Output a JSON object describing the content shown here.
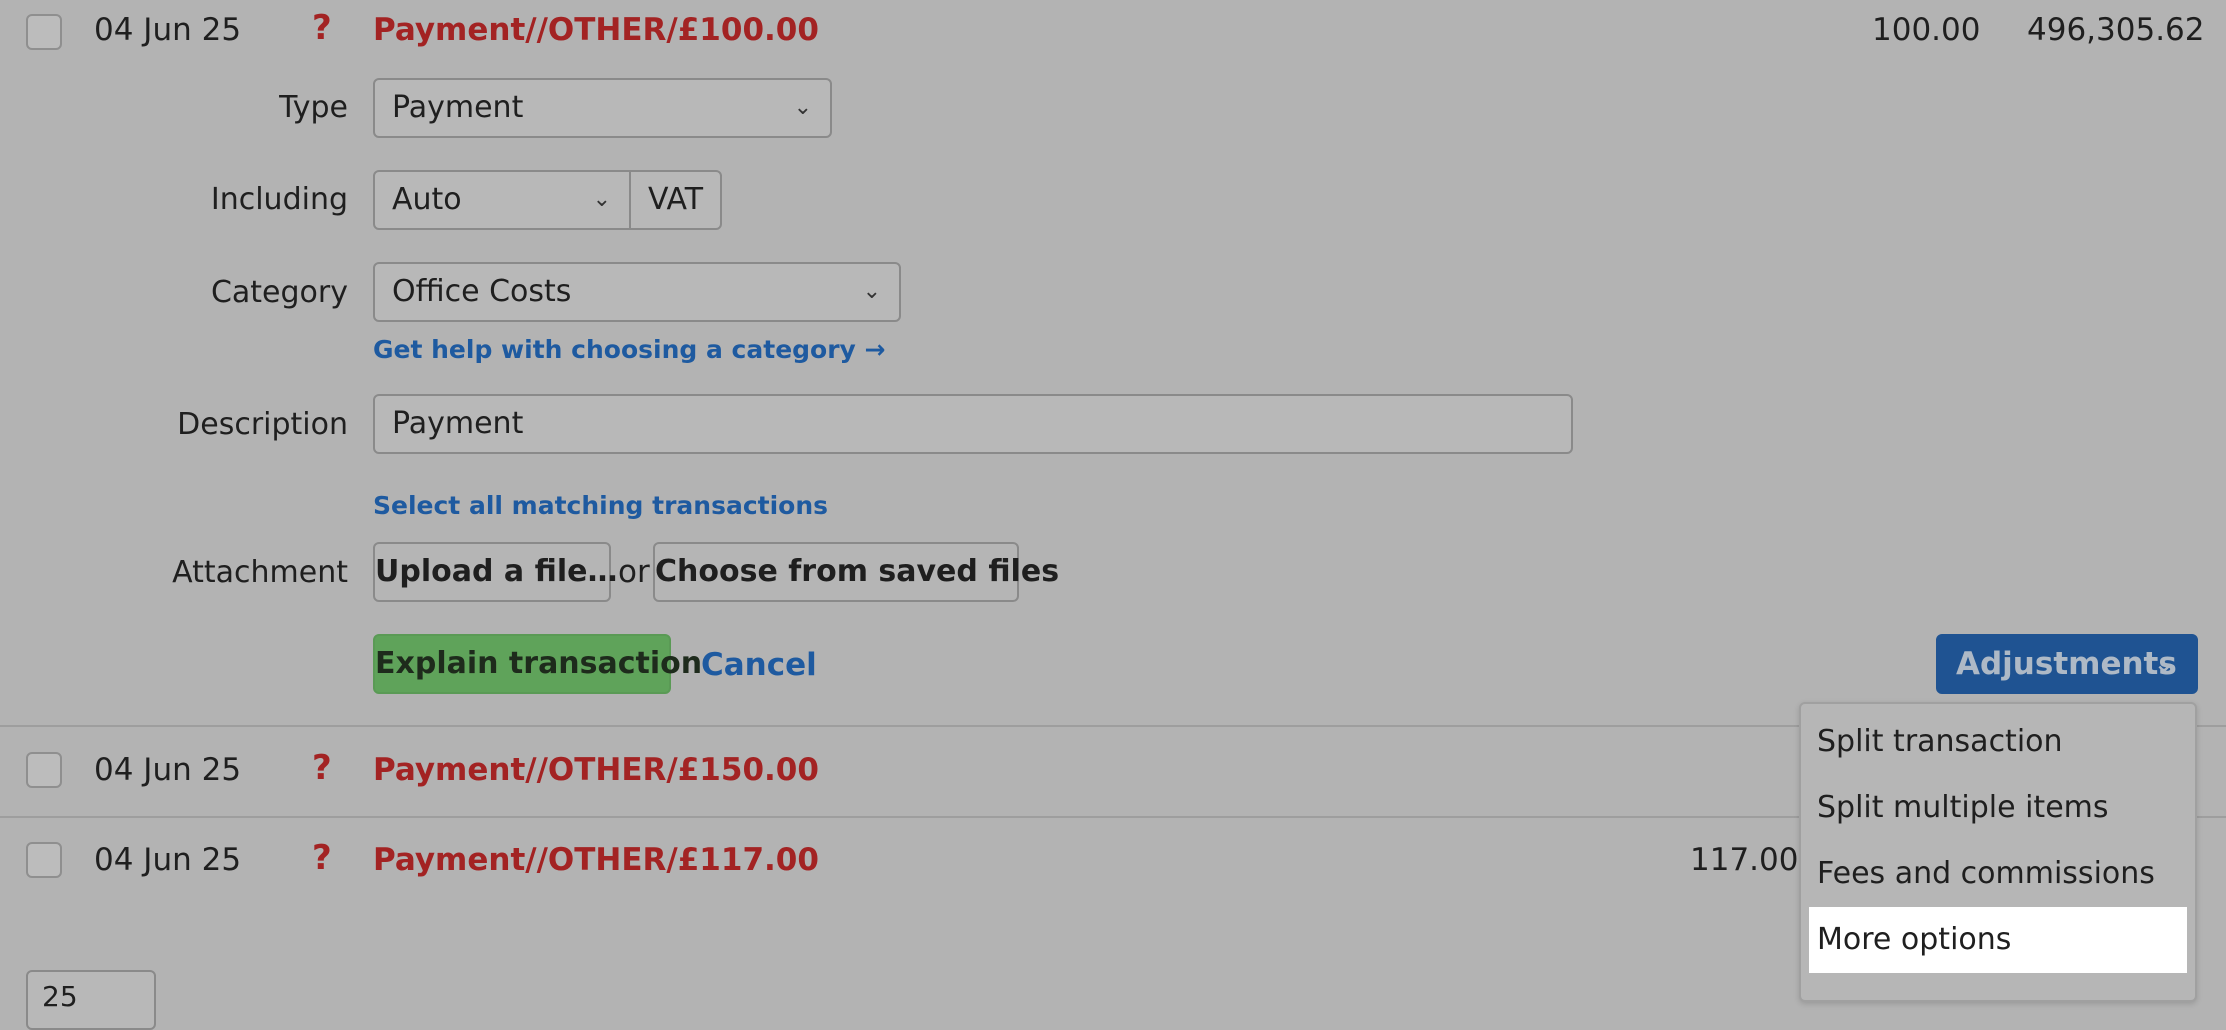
{
  "rows": [
    {
      "date": "04 Jun 25",
      "status": "?",
      "description": "Payment//OTHER/£100.00",
      "amount": "100.00",
      "balance": "496,305.62"
    },
    {
      "date": "04 Jun 25",
      "status": "?",
      "description": "Payment//OTHER/£150.00",
      "amount": "",
      "balance": ""
    },
    {
      "date": "04 Jun 25",
      "status": "?",
      "description": "Payment//OTHER/£117.00",
      "amount": "117.00",
      "balance": ""
    }
  ],
  "form": {
    "type_label": "Type",
    "type_value": "Payment",
    "including_label": "Including",
    "including_value": "Auto",
    "vat_label": "VAT",
    "category_label": "Category",
    "category_value": "Office Costs",
    "category_help": "Get help with choosing a category →",
    "description_label": "Description",
    "description_value": "Payment",
    "select_matching": "Select all matching transactions",
    "attachment_label": "Attachment",
    "upload_label": "Upload a file…",
    "or_label": "or",
    "choose_saved_label": "Choose from saved files",
    "explain_label": "Explain transaction",
    "cancel_label": "Cancel",
    "adjustments_label": "Adjustments"
  },
  "adjustments_menu": {
    "items": [
      "Split transaction",
      "Split multiple items",
      "Fees and commissions",
      "More options"
    ],
    "highlighted": "More options"
  },
  "pager": {
    "per_page": "25"
  },
  "icons": {
    "chevron": "chevron-down-icon",
    "status": "question-mark-icon"
  },
  "colors": {
    "background": "#b3b3b3",
    "link_red": "#a32323",
    "link_blue": "#1e5aa0",
    "primary_green": "#5fa35a",
    "adjustments_blue": "#1f5392"
  }
}
